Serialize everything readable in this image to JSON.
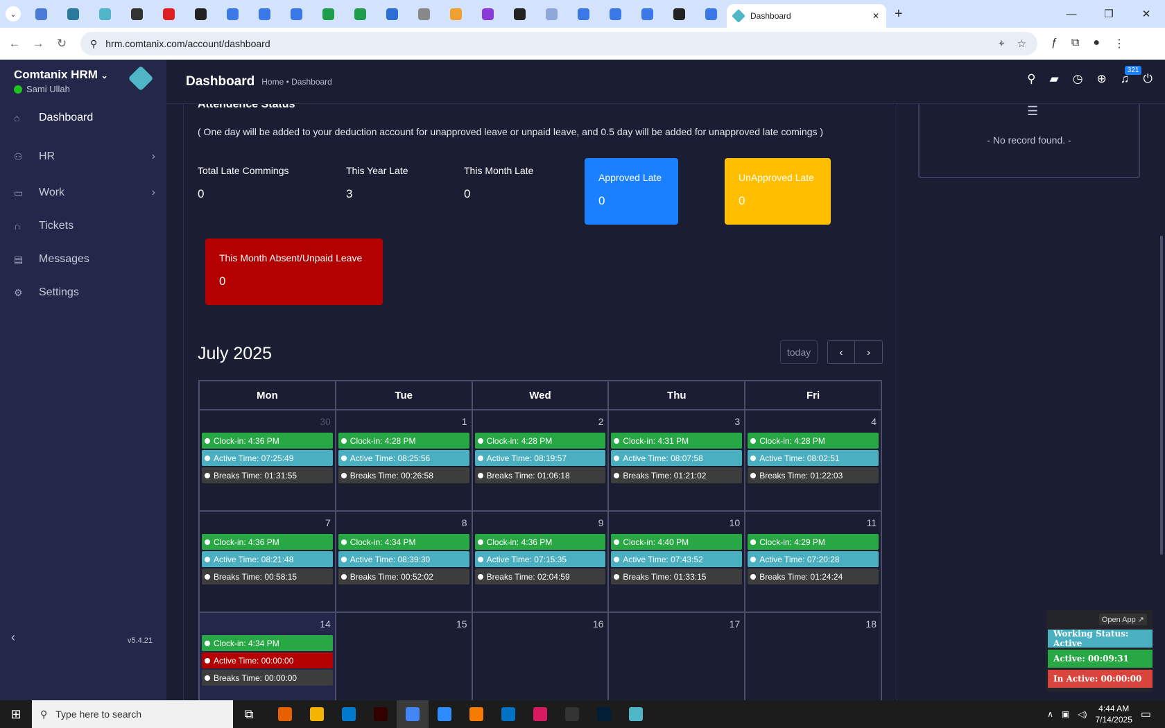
{
  "browser": {
    "active_tab_title": "Dashboard",
    "url": "hrm.comtanix.com/account/dashboard",
    "pinned_tab_colors": [
      "#4a7bd6",
      "#2c7a9e",
      "#4fb6c7",
      "#333333",
      "#e02020",
      "#222222",
      "#3b78e7",
      "#3b78e7",
      "#3b78e7",
      "#1e9e4a",
      "#1e9e4a",
      "#2b6fd6",
      "#888888",
      "#f0a030",
      "#8a3ad6",
      "#222222",
      "#8fa8d8",
      "#3b78e7",
      "#3b78e7",
      "#3b78e7",
      "#222222",
      "#3b78e7"
    ]
  },
  "sidebar": {
    "brand": "Comtanix HRM",
    "user": "Sami Ullah",
    "version": "v5.4.21",
    "items": [
      {
        "label": "Dashboard",
        "icon": "home-icon"
      },
      {
        "label": "HR",
        "icon": "users-icon"
      },
      {
        "label": "Work",
        "icon": "briefcase-icon"
      },
      {
        "label": "Tickets",
        "icon": "headset-icon"
      },
      {
        "label": "Messages",
        "icon": "message-icon"
      },
      {
        "label": "Settings",
        "icon": "gear-icon"
      }
    ]
  },
  "header": {
    "title": "Dashboard",
    "breadcrumb": "Home • Dashboard",
    "notification_count": "321"
  },
  "attendance": {
    "title": "Attendence Status",
    "note": "( One day will be added to your deduction account for unapproved leave or unpaid leave, and 0.5 day will be added for unapproved late comings )",
    "stats": [
      {
        "label": "Total Late Commings",
        "value": "0"
      },
      {
        "label": "This Year Late",
        "value": "3"
      },
      {
        "label": "This Month Late",
        "value": "0"
      }
    ],
    "boxes": [
      {
        "label": "Approved Late",
        "value": "0",
        "color": "#1a80ff"
      },
      {
        "label": "UnApproved Late",
        "value": "0",
        "color": "#ffbf00"
      },
      {
        "label": "This Month Absent/Unpaid Leave",
        "value": "0",
        "color": "#b30000"
      }
    ]
  },
  "calendar": {
    "month": "July 2025",
    "today_label": "today",
    "headers": [
      "Mon",
      "Tue",
      "Wed",
      "Thu",
      "Fri"
    ],
    "rows": [
      [
        {
          "day": "30",
          "other": true,
          "events": [
            [
              "g",
              "Clock-in: 4:36 PM"
            ],
            [
              "c",
              "Active Time: 07:25:49"
            ],
            [
              "d",
              "Breaks Time: 01:31:55"
            ]
          ]
        },
        {
          "day": "1",
          "events": [
            [
              "g",
              "Clock-in: 4:28 PM"
            ],
            [
              "c",
              "Active Time: 08:25:56"
            ],
            [
              "d",
              "Breaks Time: 00:26:58"
            ]
          ]
        },
        {
          "day": "2",
          "events": [
            [
              "g",
              "Clock-in: 4:28 PM"
            ],
            [
              "c",
              "Active Time: 08:19:57"
            ],
            [
              "d",
              "Breaks Time: 01:06:18"
            ]
          ]
        },
        {
          "day": "3",
          "events": [
            [
              "g",
              "Clock-in: 4:31 PM"
            ],
            [
              "c",
              "Active Time: 08:07:58"
            ],
            [
              "d",
              "Breaks Time: 01:21:02"
            ]
          ]
        },
        {
          "day": "4",
          "events": [
            [
              "g",
              "Clock-in: 4:28 PM"
            ],
            [
              "c",
              "Active Time: 08:02:51"
            ],
            [
              "d",
              "Breaks Time: 01:22:03"
            ]
          ]
        }
      ],
      [
        {
          "day": "7",
          "events": [
            [
              "g",
              "Clock-in: 4:36 PM"
            ],
            [
              "c",
              "Active Time: 08:21:48"
            ],
            [
              "d",
              "Breaks Time: 00:58:15"
            ]
          ]
        },
        {
          "day": "8",
          "events": [
            [
              "g",
              "Clock-in: 4:34 PM"
            ],
            [
              "c",
              "Active Time: 08:39:30"
            ],
            [
              "d",
              "Breaks Time: 00:52:02"
            ]
          ]
        },
        {
          "day": "9",
          "events": [
            [
              "g",
              "Clock-in: 4:36 PM"
            ],
            [
              "c",
              "Active Time: 07:15:35"
            ],
            [
              "d",
              "Breaks Time: 02:04:59"
            ]
          ]
        },
        {
          "day": "10",
          "events": [
            [
              "g",
              "Clock-in: 4:40 PM"
            ],
            [
              "c",
              "Active Time: 07:43:52"
            ],
            [
              "d",
              "Breaks Time: 01:33:15"
            ]
          ]
        },
        {
          "day": "11",
          "events": [
            [
              "g",
              "Clock-in: 4:29 PM"
            ],
            [
              "c",
              "Active Time: 07:20:28"
            ],
            [
              "d",
              "Breaks Time: 01:24:24"
            ]
          ]
        }
      ],
      [
        {
          "day": "14",
          "today": true,
          "events": [
            [
              "g",
              "Clock-in: 4:34 PM"
            ],
            [
              "r",
              "Active Time: 00:00:00"
            ],
            [
              "d",
              "Breaks Time: 00:00:00"
            ]
          ]
        },
        {
          "day": "15",
          "events": []
        },
        {
          "day": "16",
          "events": []
        },
        {
          "day": "17",
          "events": []
        },
        {
          "day": "18",
          "events": []
        }
      ]
    ]
  },
  "right_panel": {
    "empty_text": "- No record found. -"
  },
  "widget": {
    "open_app": "Open App ↗",
    "rows": [
      {
        "label": "Working Status: Active",
        "color": "#4ab0c1"
      },
      {
        "label": "Active: 00:09:31",
        "color": "#28a745"
      },
      {
        "label": "In Active: 00:00:00",
        "color": "#d9443c"
      }
    ]
  },
  "taskbar": {
    "search_placeholder": "Type here to search",
    "time": "4:44 AM",
    "date": "7/14/2025",
    "app_colors": [
      "#e66000",
      "#f4b400",
      "#007acc",
      "#330000",
      "#4285f4",
      "#2d8cff",
      "#f57c00",
      "#0072c6",
      "#d81b60",
      "#333333",
      "#001e36",
      "#4fb6c7"
    ]
  }
}
